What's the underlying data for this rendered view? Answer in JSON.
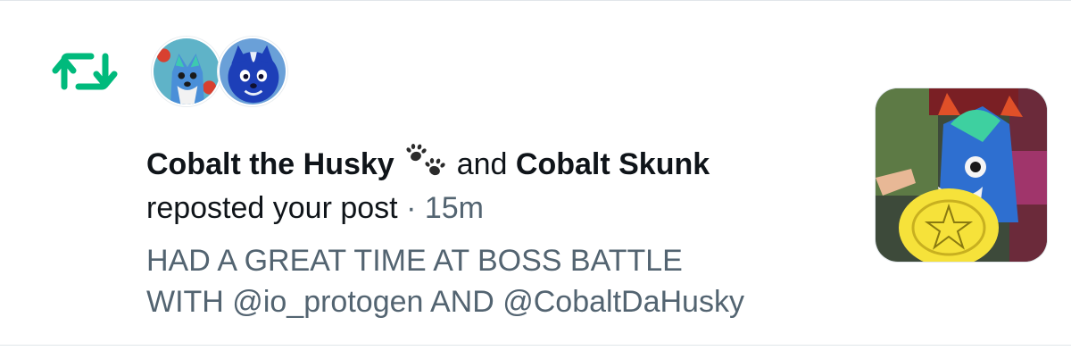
{
  "notification": {
    "type_icon": "repost-icon",
    "accent_color": "#00ba7c",
    "avatars": [
      {
        "icon": "husky-avatar",
        "alt": "Cobalt the Husky"
      },
      {
        "icon": "skunk-avatar",
        "alt": "Cobalt Skunk"
      }
    ],
    "user1_name": "Cobalt the Husky",
    "user1_emoji_icon": "paw-prints-icon",
    "conjunction": "and",
    "user2_name": "Cobalt Skunk",
    "action": "reposted your post",
    "separator": "·",
    "time_ago": "15m",
    "post_lines": [
      "HAD A GREAT TIME AT BOSS BATTLE",
      "WITH @io_protogen AND @CobaltDaHusky"
    ],
    "thumbnail_icon": "post-photo-thumbnail"
  }
}
